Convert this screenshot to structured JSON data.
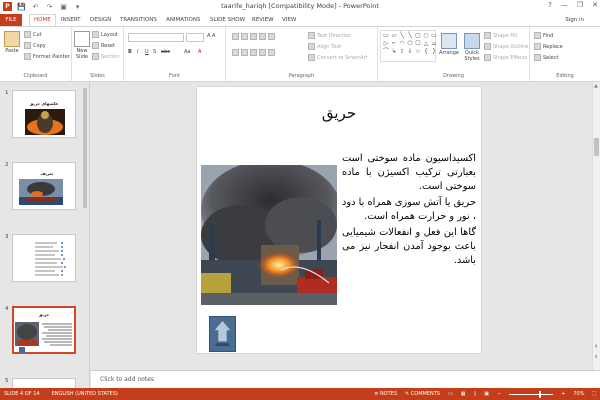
{
  "window": {
    "title": "taarife_hariqh [Compatibility Mode] - PowerPoint",
    "controls": {
      "help": "?",
      "minimize": "—",
      "restore": "❐",
      "close": "✕"
    }
  },
  "qat": {
    "logo": "P",
    "save": "💾",
    "undo": "↶",
    "redo": "↷",
    "start": "▣",
    "more": "▾"
  },
  "tabs": [
    "FILE",
    "HOME",
    "INSERT",
    "DESIGN",
    "TRANSITIONS",
    "ANIMATIONS",
    "SLIDE SHOW",
    "REVIEW",
    "VIEW"
  ],
  "signin": "Sign in",
  "ribbon": {
    "clipboard": {
      "paste": "Paste",
      "cut": "Cut",
      "copy": "Copy",
      "format_painter": "Format Painter",
      "label": "Clipboard"
    },
    "slides": {
      "new_slide": "New Slide",
      "layout": "Layout",
      "reset": "Reset",
      "section": "Section",
      "label": "Slides"
    },
    "font": {
      "label": "Font",
      "bold": "B",
      "italic": "I",
      "underline": "U",
      "shadow": "S",
      "strike": "abc",
      "case": "Aa",
      "font_color": "A"
    },
    "paragraph": {
      "text_direction": "Text Direction",
      "align_text": "Align Text",
      "smartart": "Convert to SmartArt",
      "label": "Paragraph"
    },
    "drawing": {
      "arrange": "Arrange",
      "quick_styles": "Quick Styles",
      "shape_fill": "Shape Fill",
      "shape_outline": "Shape Outline",
      "shape_effects": "Shape Effects",
      "label": "Drawing",
      "shapes": [
        "▭",
        "▱",
        "╲",
        "╲",
        "▢",
        "○",
        "▭",
        "▷",
        "⌐",
        "◠",
        "⬠",
        "☐",
        "△",
        "⌓",
        "⌒",
        "↳",
        "⇧",
        "⇩",
        "☆",
        "{",
        "}"
      ]
    },
    "editing": {
      "find": "Find",
      "replace": "Replace",
      "select": "Select",
      "label": "Editing"
    }
  },
  "thumbnails": [
    {
      "number": "1",
      "title": "عکسهای حریق"
    },
    {
      "number": "2",
      "title": "تعریف"
    },
    {
      "number": "3",
      "title": ""
    },
    {
      "number": "4",
      "title": "حریق"
    },
    {
      "number": "5",
      "title": ""
    }
  ],
  "slide": {
    "title": "حریق",
    "paragraphs": [
      "اکسیداسیون ماده سوختی است بعبارتی ترکیب اکسیژن با ماده سوختی است.",
      "حریق یا آتش سوزی همراه با دود ، نور و حرارت همراه است.",
      "گاها این فعل و انفعالات شیمیایی باعث بوجود آمدن انفجار نیز می باشد."
    ]
  },
  "notes_placeholder": "Click to add notes",
  "status": {
    "slide": "SLIDE 4 OF 14",
    "language": "ENGLISH (UNITED STATES)",
    "notes": "NOTES",
    "comments": "COMMENTS",
    "zoom": "70%"
  },
  "colors": {
    "accent": "#c43e1c",
    "selection": "#d24726"
  }
}
